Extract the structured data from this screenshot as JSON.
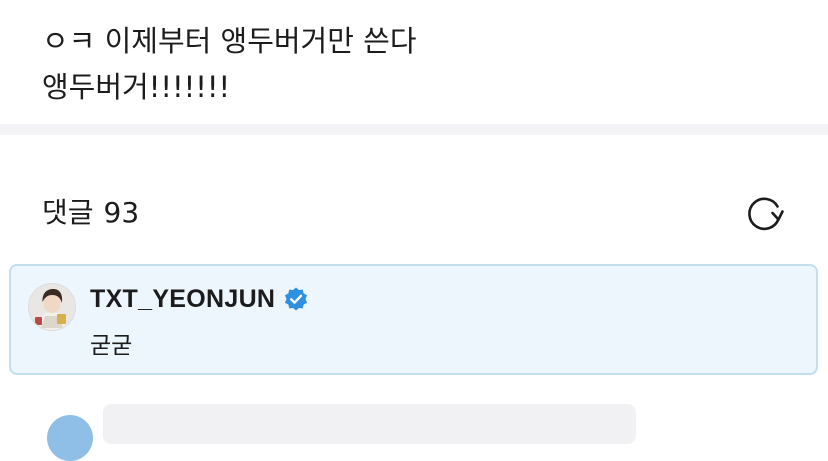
{
  "post": {
    "lines": [
      "ㅇㅋ 이제부터 앵두버거만 쓴다",
      "앵두버거!!!!!!!"
    ]
  },
  "comments": {
    "label": "댓글",
    "count": "93",
    "refresh_icon": "refresh-icon"
  },
  "highlighted_comment": {
    "author": "TXT_YEONJUN",
    "verified": true,
    "text": "굳굳",
    "colors": {
      "background": "#ecf6fc",
      "border": "#c3dfee",
      "verified_badge": "#2f8fe0"
    }
  }
}
